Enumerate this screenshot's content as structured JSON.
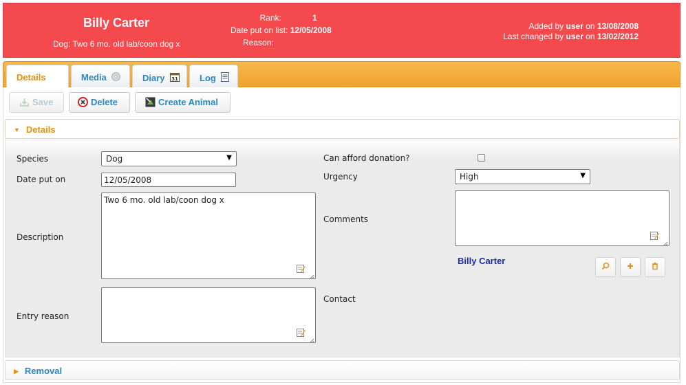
{
  "header": {
    "name": "Billy Carter",
    "subtitle": "Dog: Two 6 mo. old lab/coon dog x",
    "rank_label": "Rank:",
    "rank_value": "1",
    "date_label": "Date put on list:",
    "date_value": "12/05/2008",
    "reason_label": "Reason:",
    "added_prefix": "Added by",
    "added_user": "user",
    "added_on": "on",
    "added_date": "13/08/2008",
    "changed_prefix": "Last changed by",
    "changed_user": "user",
    "changed_on": "on",
    "changed_date": "13/02/2012",
    "color": "#f44a4e"
  },
  "tabs": [
    {
      "label": "Details",
      "icon": "none",
      "active": true
    },
    {
      "label": "Media",
      "icon": "cd-disc-icon"
    },
    {
      "label": "Diary",
      "icon": "calendar-icon"
    },
    {
      "label": "Log",
      "icon": "document-icon"
    }
  ],
  "toolbar": {
    "save_label": "Save",
    "delete_label": "Delete",
    "create_label": "Create Animal"
  },
  "sections": {
    "details_title": "Details",
    "removal_title": "Removal"
  },
  "form": {
    "species_label": "Species",
    "species_value": "Dog",
    "date_label": "Date put on",
    "date_value": "12/05/2008",
    "description_label": "Description",
    "description_value": "Two 6 mo. old lab/coon dog x",
    "entry_reason_label": "Entry reason",
    "entry_reason_value": "",
    "donation_label": "Can afford donation?",
    "donation_checked": false,
    "urgency_label": "Urgency",
    "urgency_value": "High",
    "comments_label": "Comments",
    "comments_value": "",
    "contact_label": "Contact",
    "contact_name": "Billy Carter"
  },
  "colors": {
    "accent_orange": "#e5900e",
    "link_blue": "#2a87c2",
    "person_blue": "#1a2fa8"
  }
}
